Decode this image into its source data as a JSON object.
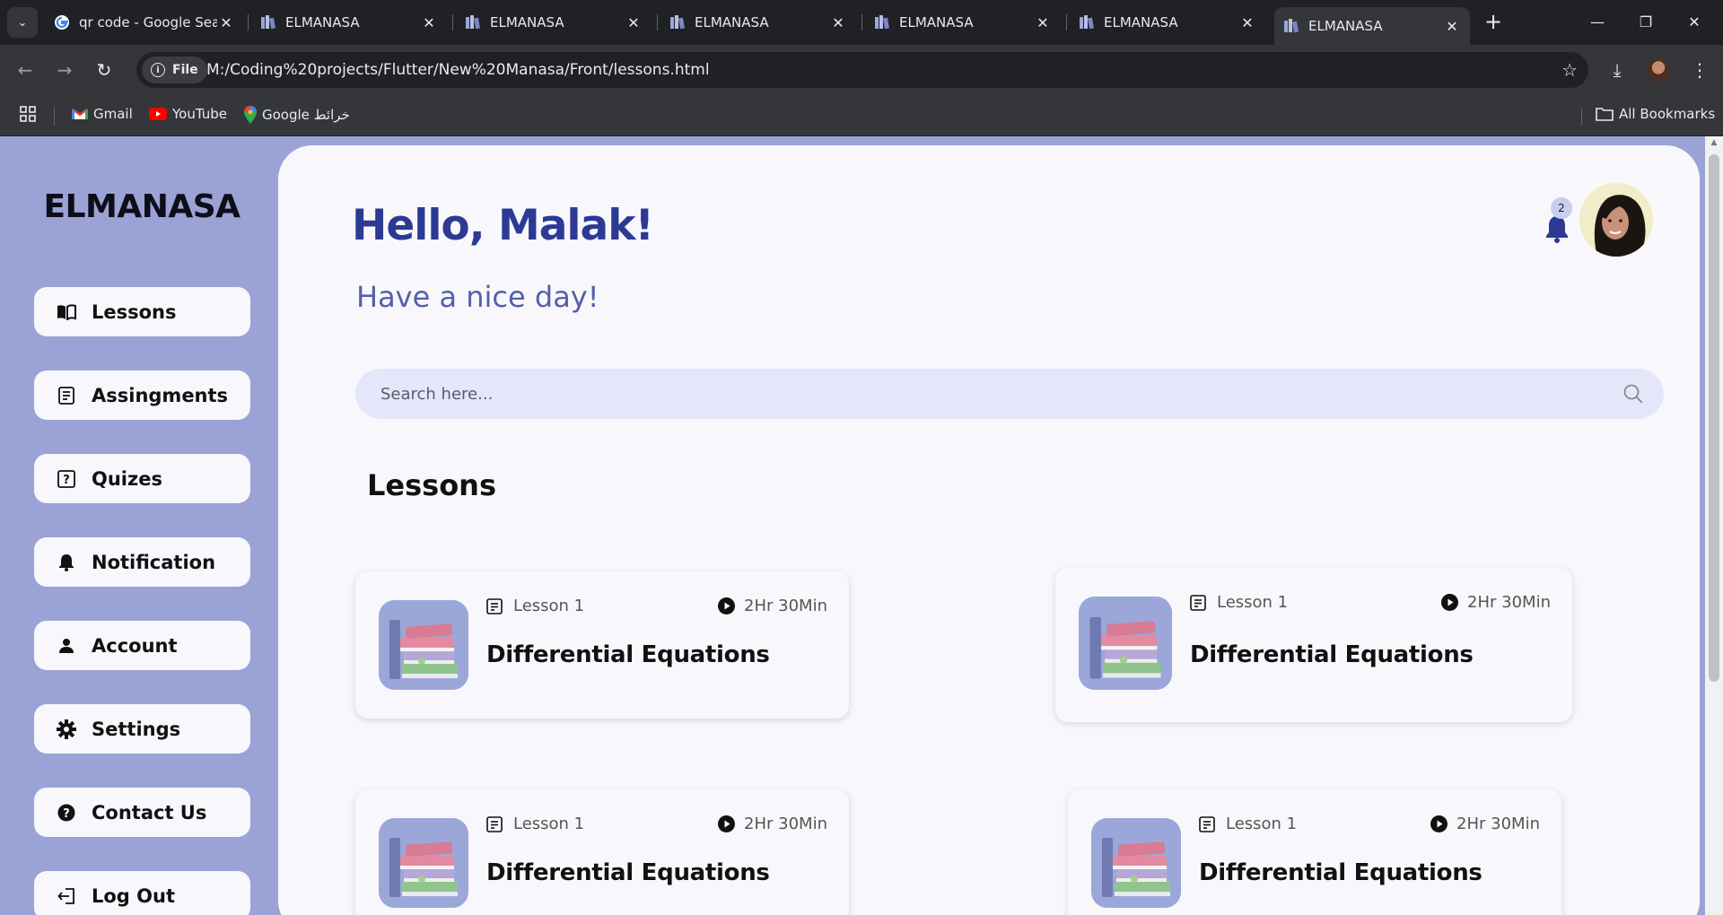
{
  "browser": {
    "tabs": [
      {
        "title": "qr code - Google Sea",
        "favicon": "google-icon",
        "active": false
      },
      {
        "title": "ELMANASA",
        "favicon": "books-icon",
        "active": false
      },
      {
        "title": "ELMANASA",
        "favicon": "books-icon",
        "active": false
      },
      {
        "title": "ELMANASA",
        "favicon": "books-icon",
        "active": false
      },
      {
        "title": "ELMANASA",
        "favicon": "books-icon",
        "active": false
      },
      {
        "title": "ELMANASA",
        "favicon": "books-icon",
        "active": false
      },
      {
        "title": "ELMANASA",
        "favicon": "books-icon",
        "active": true
      }
    ],
    "site_chip": "File",
    "url": "M:/Coding%20projects/Flutter/New%20Manasa/Front/lessons.html",
    "bookmarks": [
      {
        "label": "Gmail",
        "icon": "gmail-icon"
      },
      {
        "label": "YouTube",
        "icon": "youtube-icon"
      },
      {
        "label": "Google خرائط",
        "icon": "maps-icon"
      }
    ],
    "all_bookmarks": "All Bookmarks"
  },
  "sidebar": {
    "brand": "ELMANASA",
    "items": [
      {
        "label": "Lessons",
        "icon": "book-open-icon"
      },
      {
        "label": "Assingments",
        "icon": "assignment-icon"
      },
      {
        "label": "Quizes",
        "icon": "question-box-icon"
      },
      {
        "label": "Notification",
        "icon": "bell-icon"
      },
      {
        "label": "Account",
        "icon": "person-icon"
      },
      {
        "label": "Settings",
        "icon": "gear-icon"
      },
      {
        "label": "Contact Us",
        "icon": "help-circle-icon"
      },
      {
        "label": "Log Out",
        "icon": "logout-icon"
      }
    ]
  },
  "header": {
    "greeting": "Hello, Malak!",
    "subtitle": "Have a nice day!",
    "notification_count": "2"
  },
  "search": {
    "placeholder": "Search here..."
  },
  "lessons": {
    "title": "Lessons",
    "cards": [
      {
        "lesson": "Lesson 1",
        "duration": "2Hr 30Min",
        "name": "Differential Equations"
      },
      {
        "lesson": "Lesson 1",
        "duration": "2Hr 30Min",
        "name": "Differential Equations"
      },
      {
        "lesson": "Lesson 1",
        "duration": "2Hr 30Min",
        "name": "Differential Equations"
      },
      {
        "lesson": "Lesson 1",
        "duration": "2Hr 30Min",
        "name": "Differential Equations"
      }
    ]
  },
  "colors": {
    "sidebar_bg": "#9ba3d6",
    "greeting": "#2c3a94",
    "subtitle": "#5560a8",
    "search_bg": "#e6e6fa",
    "main_bg": "#f8f8fc"
  }
}
